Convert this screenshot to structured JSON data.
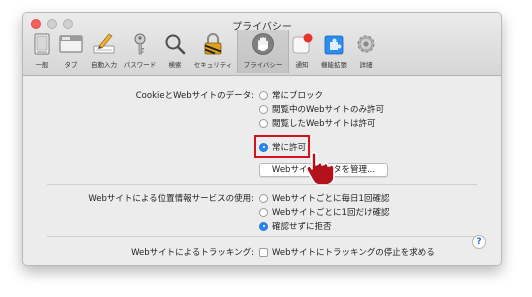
{
  "window": {
    "title": "プライバシー"
  },
  "toolbar": {
    "items": [
      {
        "label": "一般",
        "icon": "general-icon"
      },
      {
        "label": "タブ",
        "icon": "tabs-icon"
      },
      {
        "label": "自動入力",
        "icon": "autofill-icon"
      },
      {
        "label": "パスワード",
        "icon": "key-icon"
      },
      {
        "label": "検索",
        "icon": "search-icon"
      },
      {
        "label": "セキュリティ",
        "icon": "lock-icon"
      },
      {
        "label": "プライバシー",
        "icon": "hand-icon",
        "selected": true
      },
      {
        "label": "通知",
        "icon": "notification-icon"
      },
      {
        "label": "機能拡張",
        "icon": "extensions-icon"
      },
      {
        "label": "詳細",
        "icon": "gear-icon"
      }
    ]
  },
  "cookies": {
    "label": "CookieとWebサイトのデータ:",
    "options": [
      {
        "label": "常にブロック",
        "selected": false
      },
      {
        "label": "閲覧中のWebサイトのみ許可",
        "selected": false
      },
      {
        "label": "閲覧したWebサイトは許可",
        "selected": false
      },
      {
        "label": "常に許可",
        "selected": true
      }
    ],
    "manage_button": "Webサイトデータを管理..."
  },
  "location": {
    "label": "Webサイトによる位置情報サービスの使用:",
    "options": [
      {
        "label": "Webサイトごとに毎日1回確認",
        "selected": false
      },
      {
        "label": "Webサイトごとに1回だけ確認",
        "selected": false
      },
      {
        "label": "確認せずに拒否",
        "selected": true
      }
    ]
  },
  "tracking": {
    "label": "Webサイトによるトラッキング:",
    "checkbox_label": "Webサイトにトラッキングの停止を求める",
    "checked": false
  },
  "help": {
    "label": "?"
  },
  "colors": {
    "highlight": "#d4141c",
    "radio_selected": "#2a86f0",
    "cursor": "#b3121c"
  }
}
